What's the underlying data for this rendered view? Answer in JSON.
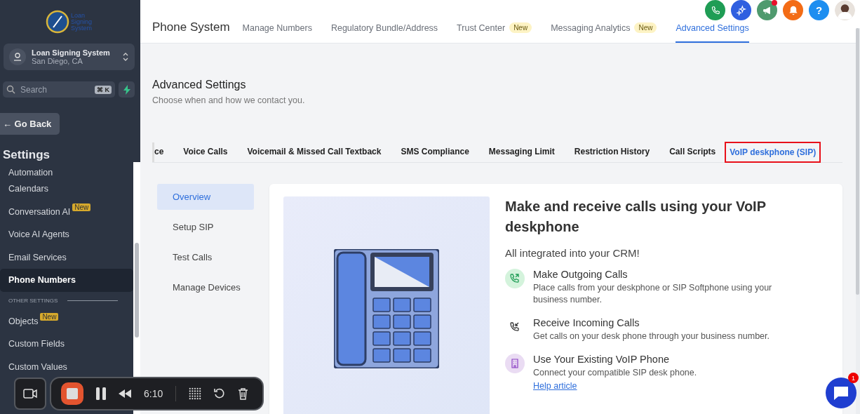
{
  "header": {
    "help": "?"
  },
  "sidebar": {
    "logo_lines": [
      "Loan",
      "Signing",
      "System"
    ],
    "account": {
      "name": "Loan Signing System",
      "location": "San Diego, CA"
    },
    "search": {
      "placeholder": "Search",
      "shortcut": "⌘ K"
    },
    "back_button": "← Go Back",
    "heading": "Settings",
    "items": [
      {
        "kind": "item",
        "label": "Automation",
        "selected": false
      },
      {
        "kind": "item",
        "label": "Calendars",
        "selected": false
      },
      {
        "kind": "item",
        "label": "Conversation AI",
        "badge": "New",
        "selected": false
      },
      {
        "kind": "item",
        "label": "Voice AI Agents",
        "selected": false
      },
      {
        "kind": "item",
        "label": "Email Services",
        "selected": false
      },
      {
        "kind": "item",
        "label": "Phone Numbers",
        "selected": true
      },
      {
        "kind": "section",
        "label": "OTHER SETTINGS"
      },
      {
        "kind": "item",
        "label": "Objects",
        "badge": "New",
        "selected": false
      },
      {
        "kind": "item",
        "label": "Custom Fields",
        "selected": false
      },
      {
        "kind": "item",
        "label": "Custom Values",
        "selected": false
      }
    ]
  },
  "page": {
    "title": "Phone System",
    "tabs": [
      {
        "label": "Manage Numbers",
        "selected": false
      },
      {
        "label": "Regulatory Bundle/Address",
        "selected": false
      },
      {
        "label": "Trust Center",
        "badge": "New",
        "selected": false
      },
      {
        "label": "Messaging Analytics",
        "badge": "New",
        "selected": false
      },
      {
        "label": "Advanced Settings",
        "selected": true
      }
    ],
    "section_title": "Advanced Settings",
    "section_subtitle": "Choose when and how we contact you.",
    "sub_tabs": [
      {
        "label": "ce",
        "selected": false
      },
      {
        "label": "Voice Calls",
        "selected": false
      },
      {
        "label": "Voicemail & Missed Call Textback",
        "selected": false
      },
      {
        "label": "SMS Compliance",
        "selected": false
      },
      {
        "label": "Messaging Limit",
        "selected": false
      },
      {
        "label": "Restriction History",
        "selected": false
      },
      {
        "label": "Call Scripts",
        "selected": false
      },
      {
        "label": "VoIP deskphone (SIP)",
        "selected": true
      }
    ],
    "side_nav": [
      {
        "label": "Overview",
        "selected": true
      },
      {
        "label": "Setup SIP",
        "selected": false
      },
      {
        "label": "Test Calls",
        "selected": false
      },
      {
        "label": "Manage Devices",
        "selected": false
      }
    ],
    "card": {
      "title": "Make and receive calls using your VoIP deskphone",
      "subtitle": "All integrated into your CRM!",
      "features": [
        {
          "kind": "outgoing",
          "title": "Make Outgoing Calls",
          "text": "Place calls from your deskphone or SIP Softphone using your business number."
        },
        {
          "kind": "incoming",
          "title": "Receive Incoming Calls",
          "text": "Get calls on your desk phone through your business number."
        },
        {
          "kind": "existing",
          "title": "Use Your Existing VoIP Phone",
          "text": "Connect your compatible SIP desk phone.",
          "link": "Help article"
        }
      ]
    }
  },
  "chat": {
    "badge": "1"
  },
  "recorder": {
    "time": "6:10"
  }
}
